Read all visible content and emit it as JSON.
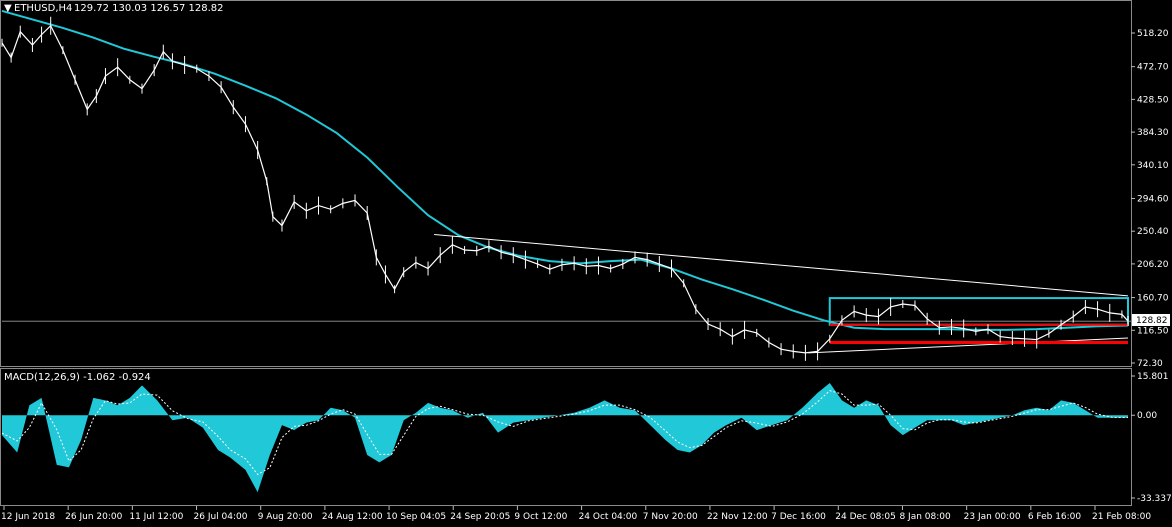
{
  "header": {
    "symbol": "ETHUSD,H4",
    "ohlc": "129.72 130.03 126.57 128.82"
  },
  "macd_header": {
    "label": "MACD(12,26,9) -1.062 -0.924"
  },
  "price_marker": "128.82",
  "colors": {
    "background": "#000000",
    "candles": "#ffffff",
    "moving_average": "#20c8d8",
    "support": "#ff0000",
    "range_box": "#20c8d8",
    "trendline": "#ffffff",
    "macd_hist": "#20c8d8",
    "macd_signal": "#ffffff"
  },
  "chart_data": [
    {
      "type": "line",
      "name": "price",
      "x_labels": [
        "12 Jun 2018",
        "26 Jun 20:00",
        "11 Jul 12:00",
        "26 Jul 04:00",
        "9 Aug 20:00",
        "24 Aug 12:00",
        "10 Sep 04:05",
        "24 Sep 20:05",
        "9 Oct 12:00",
        "24 Oct 04:00",
        "7 Nov 20:00",
        "22 Nov 12:00",
        "7 Dec 16:00",
        "24 Dec 08:05",
        "8 Jan 08:00",
        "23 Jan 00:00",
        "6 Feb 16:00",
        "21 Feb 08:00"
      ],
      "y_ticks": [
        "518.20",
        "472.70",
        "428.50",
        "384.30",
        "340.10",
        "294.60",
        "250.40",
        "206.20",
        "160.70",
        "116.50",
        "72.30"
      ],
      "ylim": [
        72.3,
        540
      ],
      "price_path": [
        {
          "x": 0,
          "y": 505
        },
        {
          "x": 0.3,
          "y": 485
        },
        {
          "x": 0.6,
          "y": 520
        },
        {
          "x": 1.0,
          "y": 502
        },
        {
          "x": 1.3,
          "y": 516
        },
        {
          "x": 1.6,
          "y": 528
        },
        {
          "x": 2.0,
          "y": 495
        },
        {
          "x": 2.4,
          "y": 455
        },
        {
          "x": 2.8,
          "y": 415
        },
        {
          "x": 3.1,
          "y": 433
        },
        {
          "x": 3.4,
          "y": 460
        },
        {
          "x": 3.8,
          "y": 472
        },
        {
          "x": 4.2,
          "y": 455
        },
        {
          "x": 4.6,
          "y": 443
        },
        {
          "x": 5.0,
          "y": 468
        },
        {
          "x": 5.3,
          "y": 493
        },
        {
          "x": 5.6,
          "y": 480
        },
        {
          "x": 6.0,
          "y": 475
        },
        {
          "x": 6.4,
          "y": 470
        },
        {
          "x": 6.8,
          "y": 460
        },
        {
          "x": 7.2,
          "y": 445
        },
        {
          "x": 7.6,
          "y": 418
        },
        {
          "x": 8.0,
          "y": 395
        },
        {
          "x": 8.4,
          "y": 360
        },
        {
          "x": 8.7,
          "y": 318
        },
        {
          "x": 8.9,
          "y": 270
        },
        {
          "x": 9.2,
          "y": 258
        },
        {
          "x": 9.6,
          "y": 290
        },
        {
          "x": 10.0,
          "y": 278
        },
        {
          "x": 10.4,
          "y": 285
        },
        {
          "x": 10.8,
          "y": 280
        },
        {
          "x": 11.2,
          "y": 288
        },
        {
          "x": 11.6,
          "y": 292
        },
        {
          "x": 12.0,
          "y": 275
        },
        {
          "x": 12.3,
          "y": 215
        },
        {
          "x": 12.6,
          "y": 192
        },
        {
          "x": 12.9,
          "y": 172
        },
        {
          "x": 13.2,
          "y": 195
        },
        {
          "x": 13.6,
          "y": 208
        },
        {
          "x": 14.0,
          "y": 200
        },
        {
          "x": 14.4,
          "y": 218
        },
        {
          "x": 14.8,
          "y": 232
        },
        {
          "x": 15.2,
          "y": 225
        },
        {
          "x": 15.6,
          "y": 224
        },
        {
          "x": 16.0,
          "y": 230
        },
        {
          "x": 16.4,
          "y": 222
        },
        {
          "x": 16.8,
          "y": 218
        },
        {
          "x": 17.2,
          "y": 212
        },
        {
          "x": 17.6,
          "y": 206
        },
        {
          "x": 18.0,
          "y": 199
        },
        {
          "x": 18.4,
          "y": 205
        },
        {
          "x": 18.8,
          "y": 207
        },
        {
          "x": 19.2,
          "y": 203
        },
        {
          "x": 19.6,
          "y": 204
        },
        {
          "x": 20.0,
          "y": 200
        },
        {
          "x": 20.4,
          "y": 206
        },
        {
          "x": 20.8,
          "y": 215
        },
        {
          "x": 21.2,
          "y": 212
        },
        {
          "x": 21.6,
          "y": 206
        },
        {
          "x": 22.0,
          "y": 200
        },
        {
          "x": 22.4,
          "y": 180
        },
        {
          "x": 22.8,
          "y": 145
        },
        {
          "x": 23.2,
          "y": 125
        },
        {
          "x": 23.6,
          "y": 118
        },
        {
          "x": 24.0,
          "y": 108
        },
        {
          "x": 24.4,
          "y": 117
        },
        {
          "x": 24.8,
          "y": 113
        },
        {
          "x": 25.2,
          "y": 100
        },
        {
          "x": 25.6,
          "y": 91
        },
        {
          "x": 26.0,
          "y": 88
        },
        {
          "x": 26.4,
          "y": 86
        },
        {
          "x": 26.8,
          "y": 88
        },
        {
          "x": 27.2,
          "y": 105
        },
        {
          "x": 27.6,
          "y": 130
        },
        {
          "x": 28.0,
          "y": 142
        },
        {
          "x": 28.4,
          "y": 137
        },
        {
          "x": 28.8,
          "y": 135
        },
        {
          "x": 29.2,
          "y": 148
        },
        {
          "x": 29.6,
          "y": 152
        },
        {
          "x": 30.0,
          "y": 150
        },
        {
          "x": 30.4,
          "y": 132
        },
        {
          "x": 30.8,
          "y": 120
        },
        {
          "x": 31.2,
          "y": 121
        },
        {
          "x": 31.6,
          "y": 119
        },
        {
          "x": 32.0,
          "y": 115
        },
        {
          "x": 32.4,
          "y": 118
        },
        {
          "x": 32.8,
          "y": 108
        },
        {
          "x": 33.2,
          "y": 106
        },
        {
          "x": 33.6,
          "y": 105
        },
        {
          "x": 34.0,
          "y": 104
        },
        {
          "x": 34.4,
          "y": 112
        },
        {
          "x": 34.8,
          "y": 124
        },
        {
          "x": 35.2,
          "y": 135
        },
        {
          "x": 35.6,
          "y": 148
        },
        {
          "x": 36.0,
          "y": 145
        },
        {
          "x": 36.4,
          "y": 140
        },
        {
          "x": 36.8,
          "y": 138
        },
        {
          "x": 37.0,
          "y": 129
        }
      ],
      "moving_average": [
        {
          "x": 0,
          "y": 548
        },
        {
          "x": 2,
          "y": 525
        },
        {
          "x": 3,
          "y": 512
        },
        {
          "x": 4,
          "y": 497
        },
        {
          "x": 5,
          "y": 486
        },
        {
          "x": 6,
          "y": 476
        },
        {
          "x": 7,
          "y": 463
        },
        {
          "x": 8,
          "y": 447
        },
        {
          "x": 9,
          "y": 430
        },
        {
          "x": 10,
          "y": 408
        },
        {
          "x": 11,
          "y": 383
        },
        {
          "x": 12,
          "y": 350
        },
        {
          "x": 13,
          "y": 310
        },
        {
          "x": 14,
          "y": 272
        },
        {
          "x": 15,
          "y": 245
        },
        {
          "x": 16,
          "y": 228
        },
        {
          "x": 17,
          "y": 217
        },
        {
          "x": 18,
          "y": 210
        },
        {
          "x": 19,
          "y": 207
        },
        {
          "x": 20,
          "y": 210
        },
        {
          "x": 21,
          "y": 212
        },
        {
          "x": 22,
          "y": 200
        },
        {
          "x": 23,
          "y": 185
        },
        {
          "x": 24,
          "y": 172
        },
        {
          "x": 25,
          "y": 158
        },
        {
          "x": 26,
          "y": 143
        },
        {
          "x": 27,
          "y": 130
        },
        {
          "x": 28,
          "y": 120
        },
        {
          "x": 29,
          "y": 118
        },
        {
          "x": 30,
          "y": 118
        },
        {
          "x": 31,
          "y": 118
        },
        {
          "x": 32,
          "y": 117
        },
        {
          "x": 33,
          "y": 117
        },
        {
          "x": 34,
          "y": 118
        },
        {
          "x": 35,
          "y": 120
        },
        {
          "x": 36,
          "y": 122
        },
        {
          "x": 37,
          "y": 123
        }
      ],
      "resistance_trendline": [
        {
          "x": 14.2,
          "y": 246
        },
        {
          "x": 37,
          "y": 163
        }
      ],
      "support_trendline": [
        {
          "x": 26.5,
          "y": 86
        },
        {
          "x": 37,
          "y": 106
        }
      ],
      "support_line_upper": {
        "x_start": 27.2,
        "x_end": 37,
        "y": 124
      },
      "support_line_lower": {
        "x_start": 27.2,
        "x_end": 37,
        "y": 100
      },
      "range_box": {
        "x_start": 27.2,
        "x_end": 37,
        "y_top": 160,
        "y_bottom": 124
      },
      "current_price": 128.82,
      "current_price_line": 128.82
    },
    {
      "type": "area",
      "name": "MACD(12,26,9)",
      "y_ticks": [
        "15.801",
        "0.00",
        "-33.337"
      ],
      "ylim": [
        -33.337,
        15.801
      ],
      "histogram": [
        {
          "x": 0,
          "y": -8
        },
        {
          "x": 0.5,
          "y": -15
        },
        {
          "x": 0.9,
          "y": 4
        },
        {
          "x": 1.3,
          "y": 7
        },
        {
          "x": 1.8,
          "y": -20
        },
        {
          "x": 2.2,
          "y": -21
        },
        {
          "x": 2.6,
          "y": -10
        },
        {
          "x": 3.0,
          "y": 7
        },
        {
          "x": 3.4,
          "y": 6
        },
        {
          "x": 3.8,
          "y": 4
        },
        {
          "x": 4.2,
          "y": 7
        },
        {
          "x": 4.6,
          "y": 12
        },
        {
          "x": 5.1,
          "y": 6
        },
        {
          "x": 5.6,
          "y": -2
        },
        {
          "x": 6.1,
          "y": -1
        },
        {
          "x": 6.6,
          "y": -5
        },
        {
          "x": 7.1,
          "y": -14
        },
        {
          "x": 7.5,
          "y": -17
        },
        {
          "x": 8.0,
          "y": -22
        },
        {
          "x": 8.4,
          "y": -31
        },
        {
          "x": 8.8,
          "y": -16
        },
        {
          "x": 9.2,
          "y": -4
        },
        {
          "x": 9.6,
          "y": -6
        },
        {
          "x": 10.0,
          "y": -3
        },
        {
          "x": 10.4,
          "y": -2
        },
        {
          "x": 10.8,
          "y": 3
        },
        {
          "x": 11.2,
          "y": 2
        },
        {
          "x": 11.6,
          "y": -1
        },
        {
          "x": 12.0,
          "y": -16
        },
        {
          "x": 12.4,
          "y": -19
        },
        {
          "x": 12.8,
          "y": -16
        },
        {
          "x": 13.2,
          "y": -2
        },
        {
          "x": 13.6,
          "y": 1
        },
        {
          "x": 14.0,
          "y": 5
        },
        {
          "x": 14.4,
          "y": 3
        },
        {
          "x": 14.8,
          "y": 2
        },
        {
          "x": 15.3,
          "y": -1
        },
        {
          "x": 15.8,
          "y": 1
        },
        {
          "x": 16.3,
          "y": -7
        },
        {
          "x": 16.8,
          "y": -3
        },
        {
          "x": 17.3,
          "y": -2
        },
        {
          "x": 17.8,
          "y": -1
        },
        {
          "x": 18.3,
          "y": 0
        },
        {
          "x": 18.8,
          "y": 1
        },
        {
          "x": 19.3,
          "y": 3
        },
        {
          "x": 19.8,
          "y": 6
        },
        {
          "x": 20.3,
          "y": 3
        },
        {
          "x": 20.8,
          "y": 2
        },
        {
          "x": 21.3,
          "y": -4
        },
        {
          "x": 21.8,
          "y": -10
        },
        {
          "x": 22.2,
          "y": -14
        },
        {
          "x": 22.6,
          "y": -15
        },
        {
          "x": 23.0,
          "y": -12
        },
        {
          "x": 23.4,
          "y": -7
        },
        {
          "x": 23.8,
          "y": -4
        },
        {
          "x": 24.3,
          "y": -1
        },
        {
          "x": 24.8,
          "y": -6
        },
        {
          "x": 25.3,
          "y": -4
        },
        {
          "x": 25.8,
          "y": -2
        },
        {
          "x": 26.3,
          "y": 3
        },
        {
          "x": 26.8,
          "y": 9
        },
        {
          "x": 27.2,
          "y": 13
        },
        {
          "x": 27.6,
          "y": 6
        },
        {
          "x": 28.0,
          "y": 3
        },
        {
          "x": 28.4,
          "y": 6
        },
        {
          "x": 28.8,
          "y": 4
        },
        {
          "x": 29.2,
          "y": -4
        },
        {
          "x": 29.6,
          "y": -8
        },
        {
          "x": 30.0,
          "y": -5
        },
        {
          "x": 30.4,
          "y": -2
        },
        {
          "x": 30.8,
          "y": -2
        },
        {
          "x": 31.2,
          "y": -2
        },
        {
          "x": 31.6,
          "y": -4
        },
        {
          "x": 32.0,
          "y": -3
        },
        {
          "x": 32.4,
          "y": -2
        },
        {
          "x": 32.8,
          "y": -1
        },
        {
          "x": 33.2,
          "y": 0
        },
        {
          "x": 33.6,
          "y": 2
        },
        {
          "x": 34.0,
          "y": 3
        },
        {
          "x": 34.4,
          "y": 2
        },
        {
          "x": 34.8,
          "y": 6
        },
        {
          "x": 35.2,
          "y": 5
        },
        {
          "x": 35.6,
          "y": 2
        },
        {
          "x": 36.0,
          "y": -1
        },
        {
          "x": 36.5,
          "y": -1
        },
        {
          "x": 37.0,
          "y": -1
        }
      ]
    }
  ]
}
